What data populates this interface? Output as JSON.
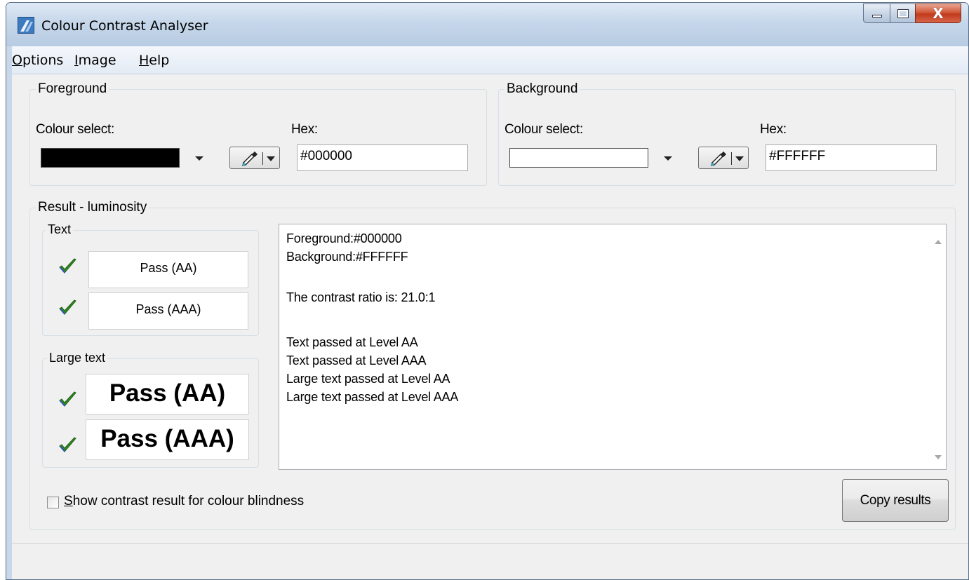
{
  "window": {
    "title": "Colour Contrast Analyser",
    "close_glyph": "X"
  },
  "menu": {
    "items": [
      {
        "label_first": "O",
        "label_rest": "ptions"
      },
      {
        "label_first": "I",
        "label_rest": "mage"
      },
      {
        "label_first": "H",
        "label_rest": "elp"
      }
    ]
  },
  "foreground": {
    "group_label": "Foreground",
    "colour_select_label": "Colour select:",
    "hex_label": "Hex:",
    "hex_value": "#000000",
    "swatch_color": "#000000"
  },
  "background": {
    "group_label": "Background",
    "colour_select_label": "Colour select:",
    "hex_label": "Hex:",
    "hex_value": "#FFFFFF",
    "swatch_color": "#FFFFFF"
  },
  "result": {
    "group_label": "Result - luminosity",
    "text_group": {
      "label": "Text",
      "aa": "Pass (AA)",
      "aaa": "Pass (AAA)"
    },
    "large_text_group": {
      "label": "Large text",
      "aa": "Pass (AA)",
      "aaa": "Pass (AAA)"
    },
    "details": {
      "line1": "Foreground:#000000",
      "line2": "Background:#FFFFFF",
      "line3": "The contrast ratio is: 21.0:1",
      "line4": "Text passed at Level AA",
      "line5": "Text passed at Level AAA",
      "line6": "Large text passed at Level AA",
      "line7": "Large text passed at Level AAA"
    }
  },
  "footer": {
    "colour_blind_first": "S",
    "colour_blind_rest": "how contrast result for colour blindness",
    "copy_button": "Copy results"
  },
  "icons": {
    "pass": "check-icon",
    "picker": "eyedropper-icon"
  },
  "colors": {
    "check_green": "#2e8b1f",
    "titlebar": "#c6d7ea",
    "close_red": "#c13a1c"
  }
}
